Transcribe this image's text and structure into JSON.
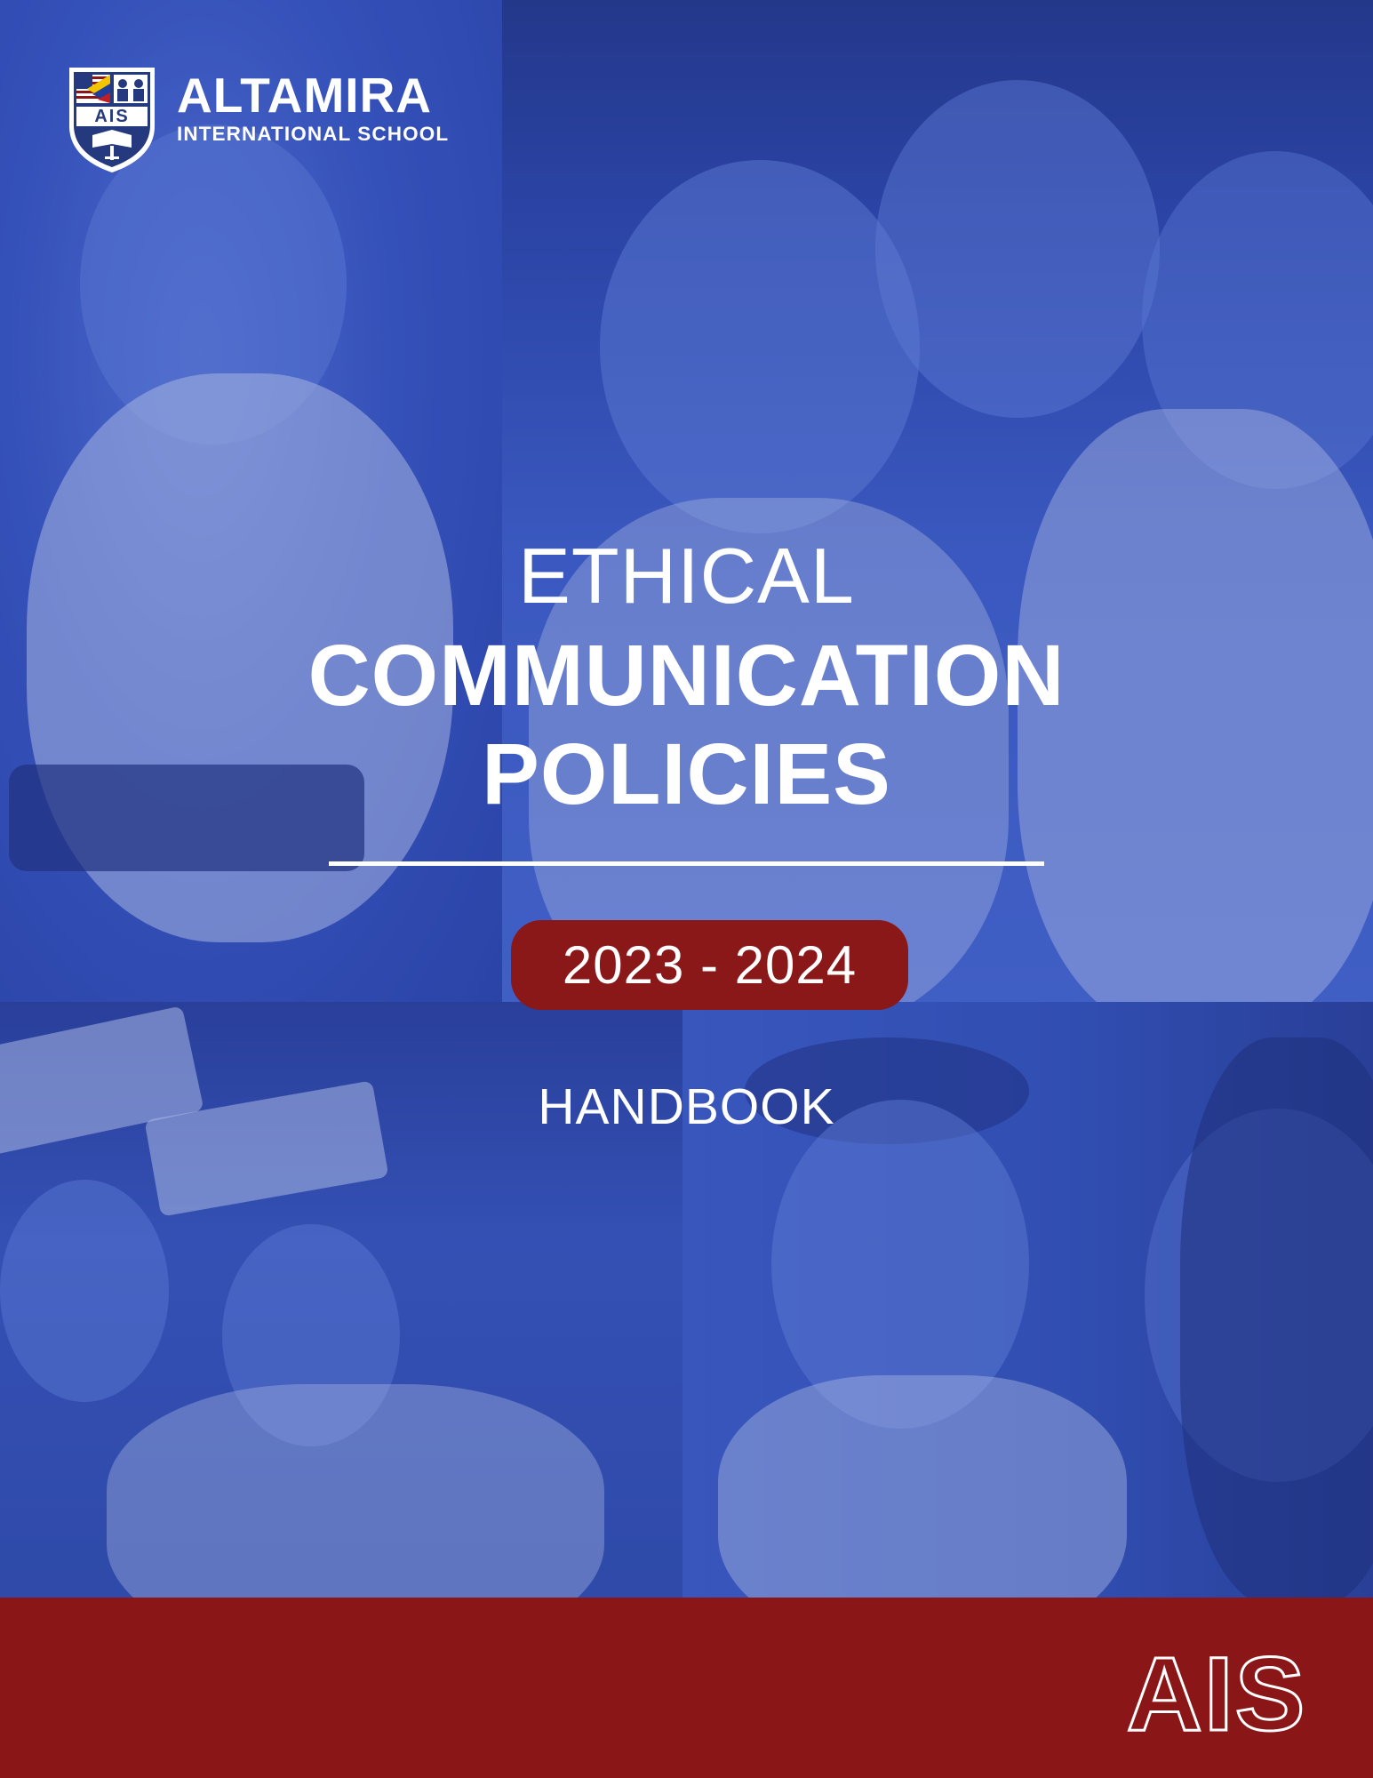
{
  "school": {
    "name": "ALTAMIRA",
    "subtitle": "INTERNATIONAL SCHOOL",
    "shield_letters": "AIS"
  },
  "cover": {
    "title_line1": "ETHICAL",
    "title_line2": "COMMUNICATION",
    "title_line3": "POLICIES",
    "year": "2023 - 2024",
    "document_type": "HANDBOOK"
  },
  "footer": {
    "mark": "AIS"
  },
  "colors": {
    "overlay_blue": "#2f4aa8",
    "accent_red": "#8a1618",
    "text": "#ffffff"
  },
  "icons": [
    "school-shield-icon",
    "ais-outline-logo"
  ]
}
